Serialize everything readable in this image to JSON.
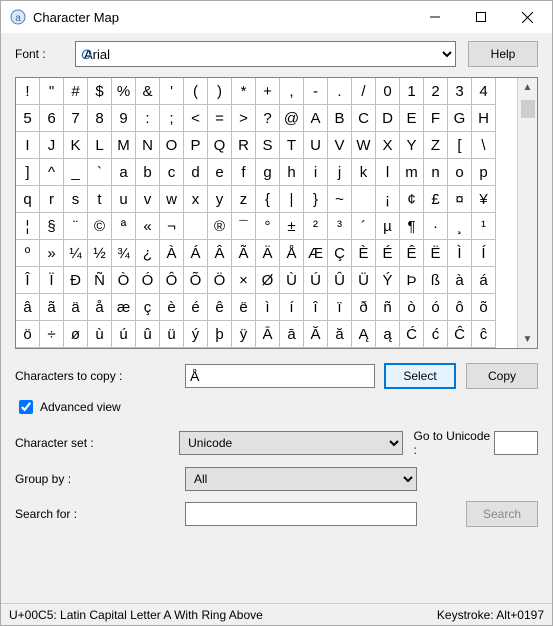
{
  "window": {
    "title": "Character Map"
  },
  "toolbar": {
    "font_label": "Font :",
    "font_value": "    Arial",
    "help_label": "Help"
  },
  "grid": {
    "chars": [
      "!",
      "\"",
      "#",
      "$",
      "%",
      "&",
      "'",
      "(",
      ")",
      "*",
      "+",
      ",",
      "-",
      ".",
      "/",
      "0",
      "1",
      "2",
      "3",
      "4",
      "5",
      "6",
      "7",
      "8",
      "9",
      ":",
      ";",
      "<",
      "=",
      ">",
      "?",
      "@",
      "A",
      "B",
      "C",
      "D",
      "E",
      "F",
      "G",
      "H",
      "I",
      "J",
      "K",
      "L",
      "M",
      "N",
      "O",
      "P",
      "Q",
      "R",
      "S",
      "T",
      "U",
      "V",
      "W",
      "X",
      "Y",
      "Z",
      "[",
      "\\",
      "]",
      "^",
      "_",
      "`",
      "a",
      "b",
      "c",
      "d",
      "e",
      "f",
      "g",
      "h",
      "i",
      "j",
      "k",
      "l",
      "m",
      "n",
      "o",
      "p",
      "q",
      "r",
      "s",
      "t",
      "u",
      "v",
      "w",
      "x",
      "y",
      "z",
      "{",
      "|",
      "}",
      "~",
      "",
      "¡",
      "¢",
      "£",
      "¤",
      "¥",
      "¦",
      "§",
      "¨",
      "©",
      "ª",
      "«",
      "¬",
      "­",
      "®",
      "¯",
      "°",
      "±",
      "²",
      "³",
      "´",
      "µ",
      "¶",
      "·",
      "¸",
      "¹",
      "º",
      "»",
      "¼",
      "½",
      "¾",
      "¿",
      "À",
      "Á",
      "Â",
      "Ã",
      "Ä",
      "Å",
      "Æ",
      "Ç",
      "È",
      "É",
      "Ê",
      "Ë",
      "Ì",
      "Í",
      "Î",
      "Ï",
      "Ð",
      "Ñ",
      "Ò",
      "Ó",
      "Ô",
      "Õ",
      "Ö",
      "×",
      "Ø",
      "Ù",
      "Ú",
      "Û",
      "Ü",
      "Ý",
      "Þ",
      "ß",
      "à",
      "á",
      "â",
      "ã",
      "ä",
      "å",
      "æ",
      "ç",
      "è",
      "é",
      "ê",
      "ë",
      "ì",
      "í",
      "î",
      "ï",
      "ð",
      "ñ",
      "ò",
      "ó",
      "ô",
      "õ",
      "ö",
      "÷",
      "ø",
      "ù",
      "ú",
      "û",
      "ü",
      "ý",
      "þ",
      "ÿ",
      "Ā",
      "ā",
      "Ă",
      "ă",
      "Ą",
      "ą",
      "Ć",
      "ć",
      "Ĉ",
      "ĉ"
    ]
  },
  "copy": {
    "label": "Characters to copy :",
    "value": "Å",
    "select_label": "Select",
    "copy_label": "Copy"
  },
  "advanced": {
    "checkbox_label": "Advanced view",
    "checked": true,
    "charset_label": "Character set :",
    "charset_value": "Unicode",
    "goto_label": "Go to Unicode :",
    "group_label": "Group by :",
    "group_value": "All",
    "search_label": "Search for :",
    "search_value": "",
    "search_btn": "Search"
  },
  "status": {
    "left": "U+00C5: Latin Capital Letter A With Ring Above",
    "right": "Keystroke: Alt+0197"
  }
}
